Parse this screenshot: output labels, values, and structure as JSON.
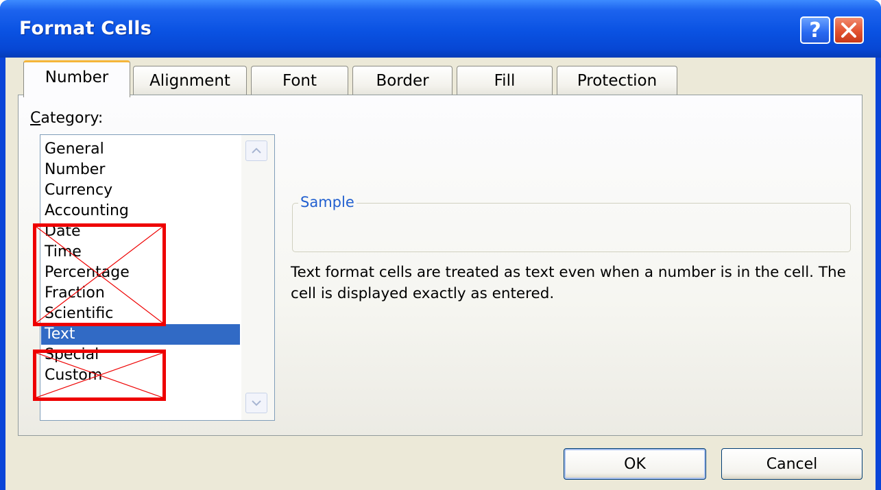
{
  "window": {
    "title": "Format Cells"
  },
  "titlebar_buttons": {
    "help_glyph": "?",
    "close_icon": "close-icon"
  },
  "tabs": [
    {
      "label": "Number",
      "active": true
    },
    {
      "label": "Alignment",
      "active": false
    },
    {
      "label": "Font",
      "active": false
    },
    {
      "label": "Border",
      "active": false
    },
    {
      "label": "Fill",
      "active": false
    },
    {
      "label": "Protection",
      "active": false
    }
  ],
  "category": {
    "label_access": "C",
    "label_rest": "ategory:",
    "items": [
      "General",
      "Number",
      "Currency",
      "Accounting",
      "Date",
      "Time",
      "Percentage",
      "Fraction",
      "Scientific",
      "Text",
      "Special",
      "Custom"
    ],
    "selected": "Text"
  },
  "sample": {
    "legend": "Sample",
    "value": ""
  },
  "description": "Text format cells are treated as text even when a number is in the cell.  The cell is displayed exactly as entered.",
  "buttons": {
    "ok": "OK",
    "cancel": "Cancel"
  },
  "annotations": {
    "color": "#ee0000",
    "crossed_out": [
      "Date",
      "Time",
      "Percentage",
      "Fraction",
      "Scientific",
      "Special",
      "Custom"
    ]
  },
  "colors": {
    "titlebar": "#0a52e2",
    "selection": "#316ac5",
    "dialog_bg": "#ece9d8",
    "active_tab_accent": "#f5b53a"
  }
}
